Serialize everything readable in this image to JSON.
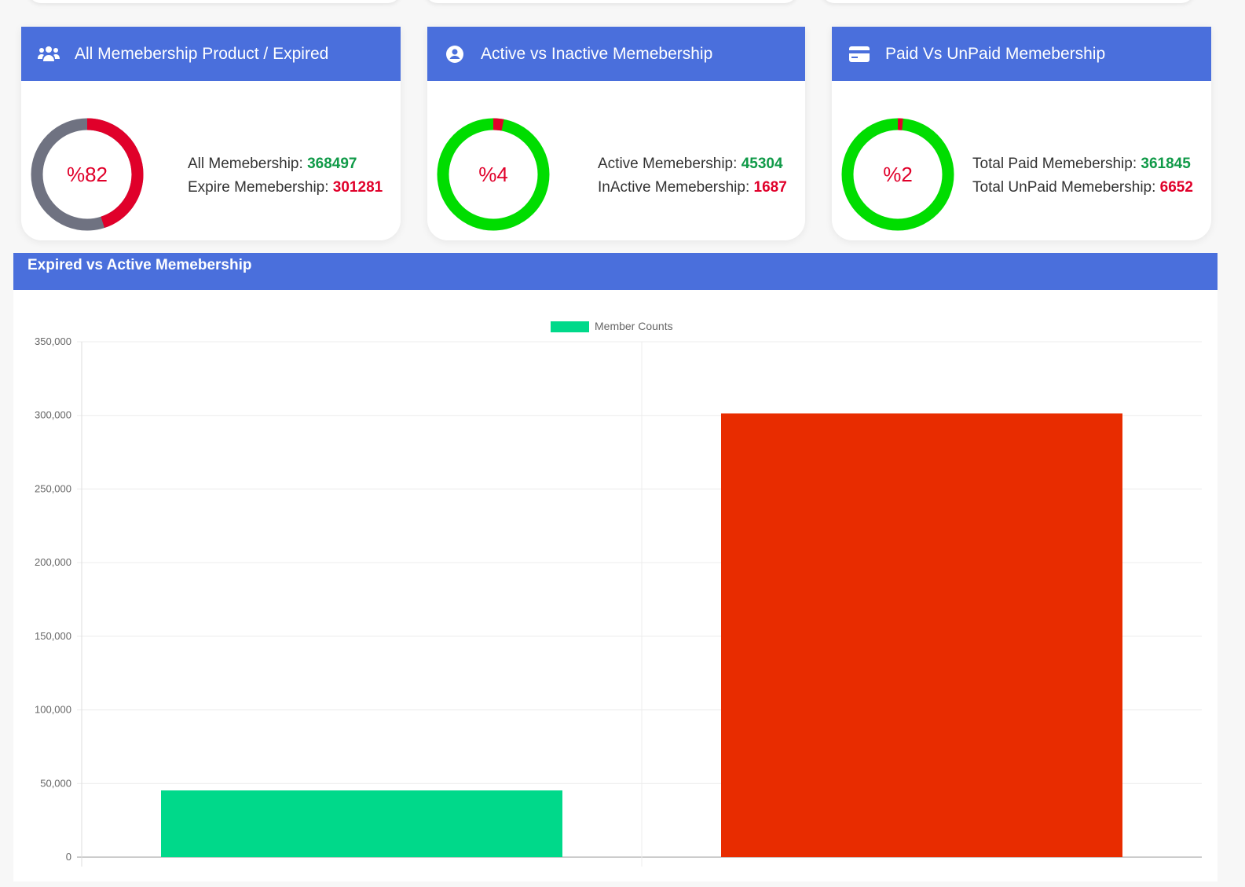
{
  "cards": [
    {
      "title": "All Memebership Product / Expired",
      "icon": "users-icon",
      "percent": "%82",
      "red_fraction": 0.45,
      "base_color": "#6f7281",
      "accent_color": "#e0002a",
      "stat1_label": "All Memebership: ",
      "stat1_value": "368497",
      "stat2_label": "Expire Memebership: ",
      "stat2_value": "301281"
    },
    {
      "title": "Active vs Inactive Memebership",
      "icon": "user-circle-icon",
      "percent": "%4",
      "red_fraction": 0.03,
      "base_color": "#00dd00",
      "accent_color": "#e0002a",
      "stat1_label": "Active Memebership: ",
      "stat1_value": "45304",
      "stat2_label": "InActive Memebership: ",
      "stat2_value": "1687"
    },
    {
      "title": "Paid Vs UnPaid Memebership",
      "icon": "credit-card-icon",
      "percent": "%2",
      "red_fraction": 0.015,
      "base_color": "#00dd00",
      "accent_color": "#e0002a",
      "stat1_label": "Total Paid Memebership: ",
      "stat1_value": "361845",
      "stat2_label": "Total UnPaid Memebership: ",
      "stat2_value": "6652"
    }
  ],
  "panel": {
    "title": "Expired vs Active Memebership"
  },
  "chart_data": {
    "type": "bar",
    "categories": [
      "",
      ""
    ],
    "series": [
      {
        "name": "Member Counts",
        "values": [
          45304,
          301281
        ],
        "colors": [
          "#00d98a",
          "#e82c00"
        ]
      }
    ],
    "legend_color": "#00d98a",
    "legend": "top",
    "ylim": [
      0,
      350000
    ],
    "yticks": [
      "0",
      "50,000",
      "100,000",
      "150,000",
      "200,000",
      "250,000",
      "300,000",
      "350,000"
    ],
    "grid": true
  }
}
